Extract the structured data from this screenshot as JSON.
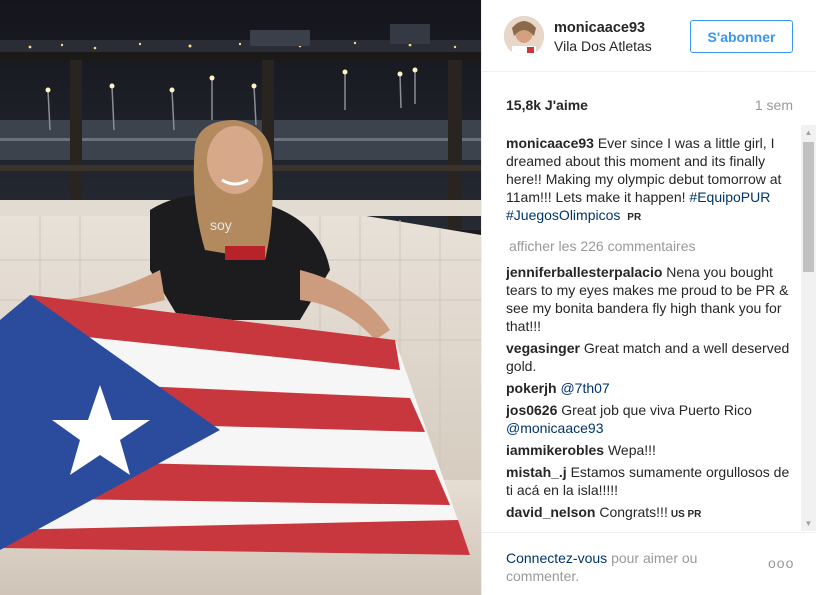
{
  "post": {
    "username": "monicaace93",
    "location": "Vila Dos Atletas",
    "follow_label": "S'abonner",
    "likes": "15,8k J'aime",
    "time": "1 sem"
  },
  "caption": {
    "user": "monicaace93",
    "text": "Ever since I was a little girl, I dreamed about this moment and its finally here!! Making my olympic debut tomorrow at 11am!!! Lets make it happen!",
    "tag1": "#EquipoPUR",
    "tag2": "#JuegosOlimpicos",
    "flag_text": "PR"
  },
  "load_more": "afficher les 226 commentaires",
  "comments": [
    {
      "user": "jenniferballesterpalacio",
      "text": "Nena you bought tears to my eyes makes me proud to be PR & see my bonita bandera fly high thank you for that!!!"
    },
    {
      "user": "vegasinger",
      "text": "Great match and a well deserved gold."
    },
    {
      "user": "pokerjh",
      "mention": "@7th07"
    },
    {
      "user": "jos0626",
      "text": "Great job que viva Puerto Rico",
      "mention": "@monicaace93"
    },
    {
      "user": "iammikerobles",
      "text": "Wepa!!!"
    },
    {
      "user": "mistah_.j",
      "text": "Estamos sumamente orgullosos de ti acá en la isla!!!!!"
    },
    {
      "user": "david_nelson",
      "text": "Congrats!!!",
      "flag_text": "US PR"
    }
  ],
  "footer": {
    "login_link": "Connectez-vous",
    "login_rest": "pour aimer ou commenter.",
    "options": "ooo"
  },
  "colors": {
    "link": "#003569",
    "accent": "#3897f0",
    "muted": "#999999",
    "flag_red": "#c8373d",
    "flag_blue": "#2b4c9c"
  },
  "icons": {
    "scroll_up": "triangle-up",
    "scroll_down": "triangle-down",
    "more_options": "three-dots"
  }
}
